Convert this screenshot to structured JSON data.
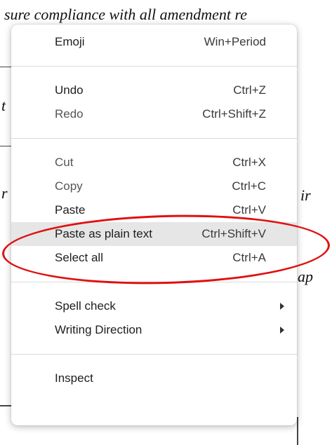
{
  "background_doc": {
    "top_line": "sure compliance with all amendment re",
    "mid_right_1": "ir",
    "mid_right_2": "ap",
    "left_fragment_1": "t",
    "left_fragment_2": "r"
  },
  "context_menu": {
    "groups": [
      [
        {
          "label": "Emoji",
          "shortcut": "Win+Period",
          "enabled": true
        }
      ],
      [
        {
          "label": "Undo",
          "shortcut": "Ctrl+Z",
          "enabled": true
        },
        {
          "label": "Redo",
          "shortcut": "Ctrl+Shift+Z",
          "enabled": false
        }
      ],
      [
        {
          "label": "Cut",
          "shortcut": "Ctrl+X",
          "enabled": false
        },
        {
          "label": "Copy",
          "shortcut": "Ctrl+C",
          "enabled": false
        },
        {
          "label": "Paste",
          "shortcut": "Ctrl+V",
          "enabled": true
        },
        {
          "label": "Paste as plain text",
          "shortcut": "Ctrl+Shift+V",
          "enabled": true,
          "highlighted": true
        },
        {
          "label": "Select all",
          "shortcut": "Ctrl+A",
          "enabled": true
        }
      ],
      [
        {
          "label": "Spell check",
          "submenu": true,
          "enabled": true
        },
        {
          "label": "Writing Direction",
          "submenu": true,
          "enabled": true
        }
      ],
      [
        {
          "label": "Inspect",
          "enabled": true
        }
      ]
    ]
  },
  "annotation": {
    "color": "#e01010",
    "shape": "ellipse",
    "target": "Paste as plain text"
  }
}
